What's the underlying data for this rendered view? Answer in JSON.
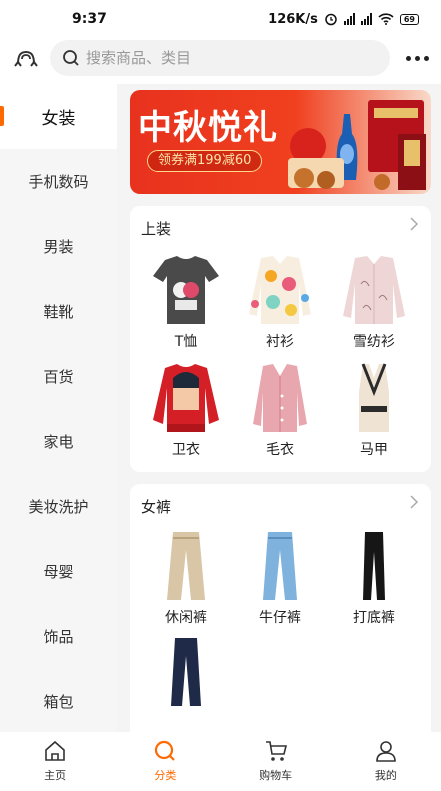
{
  "status": {
    "time": "9:37",
    "speed": "126K/s",
    "battery": "69"
  },
  "search": {
    "placeholder": "搜索商品、类目"
  },
  "sidebar": {
    "items": [
      {
        "label": "女装"
      },
      {
        "label": "手机数码"
      },
      {
        "label": "男装"
      },
      {
        "label": "鞋靴"
      },
      {
        "label": "百货"
      },
      {
        "label": "家电"
      },
      {
        "label": "美妆洗护"
      },
      {
        "label": "母婴"
      },
      {
        "label": "饰品"
      },
      {
        "label": "箱包"
      }
    ]
  },
  "banner": {
    "title": "中秋悦礼",
    "coupon": "领券满199减60"
  },
  "sections": [
    {
      "title": "上装",
      "items": [
        {
          "label": "T恤"
        },
        {
          "label": "衬衫"
        },
        {
          "label": "雪纺衫"
        },
        {
          "label": "卫衣"
        },
        {
          "label": "毛衣"
        },
        {
          "label": "马甲"
        }
      ]
    },
    {
      "title": "女裤",
      "items": [
        {
          "label": "休闲裤"
        },
        {
          "label": "牛仔裤"
        },
        {
          "label": "打底裤"
        },
        {
          "label": ""
        }
      ]
    }
  ],
  "tabs": [
    {
      "label": "主页"
    },
    {
      "label": "分类"
    },
    {
      "label": "购物车"
    },
    {
      "label": "我的"
    }
  ],
  "colors": {
    "accent": "#ff6a00",
    "banner": "#e8321e"
  }
}
